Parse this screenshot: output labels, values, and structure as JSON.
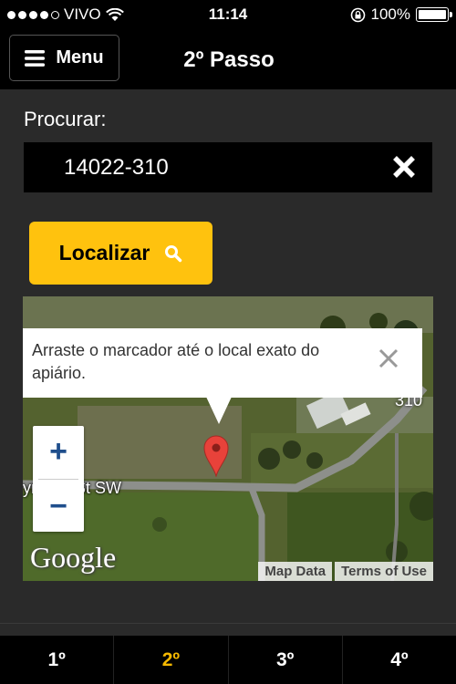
{
  "status_bar": {
    "carrier": "VIVO",
    "time": "11:14",
    "battery": "100%",
    "signal_dots": 5,
    "signal_filled": 4
  },
  "nav": {
    "menu_label": "Menu",
    "title": "2º Passo"
  },
  "search": {
    "label": "Procurar:",
    "value": "14022-310"
  },
  "locate_button": {
    "label": "Localizar"
  },
  "map": {
    "info_text": "Arraste o marcador até o local exato do apiário.",
    "street_label": "ynfield St SW",
    "road_number": "310",
    "zoom_in": "+",
    "zoom_out": "−",
    "logo": "Google",
    "map_data": "Map Data",
    "terms": "Terms of Use"
  },
  "steps": [
    {
      "label": "1º",
      "active": false
    },
    {
      "label": "2º",
      "active": true
    },
    {
      "label": "3º",
      "active": false
    },
    {
      "label": "4º",
      "active": false
    }
  ],
  "colors": {
    "accent": "#ffc20e",
    "active_step": "#f5b800",
    "background": "#2a2a2a",
    "bar": "#000000"
  }
}
